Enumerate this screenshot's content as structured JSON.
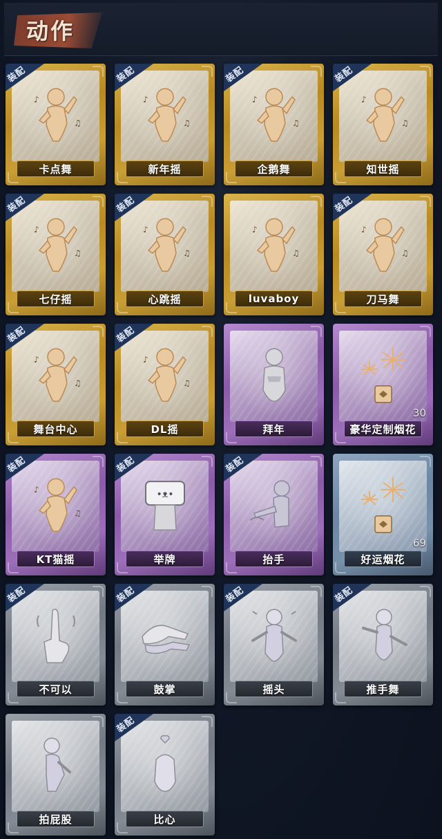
{
  "header": {
    "title": "动作"
  },
  "equip_badge_label": "装配",
  "rarity_colors": {
    "gold": "#c99e34",
    "purple": "#9d6fbb",
    "blue": "#7891ab",
    "gray": "#848b94"
  },
  "emotes": [
    {
      "label": "卡点舞",
      "rarity": "gold",
      "equipped": true,
      "icon": "dance-pose-icon"
    },
    {
      "label": "新年摇",
      "rarity": "gold",
      "equipped": true,
      "icon": "dance-pose-icon"
    },
    {
      "label": "企鹅舞",
      "rarity": "gold",
      "equipped": true,
      "icon": "dance-pose-icon"
    },
    {
      "label": "知世摇",
      "rarity": "gold",
      "equipped": true,
      "icon": "dance-pose-icon"
    },
    {
      "label": "七仔摇",
      "rarity": "gold",
      "equipped": true,
      "icon": "dance-pose-icon"
    },
    {
      "label": "心跳摇",
      "rarity": "gold",
      "equipped": true,
      "icon": "dance-pose-icon"
    },
    {
      "label": "luvaboy",
      "rarity": "gold",
      "equipped": false,
      "icon": "dance-pose-icon"
    },
    {
      "label": "刀马舞",
      "rarity": "gold",
      "equipped": true,
      "icon": "dance-pose-icon"
    },
    {
      "label": "舞台中心",
      "rarity": "gold",
      "equipped": true,
      "icon": "dance-pose-icon"
    },
    {
      "label": "DL摇",
      "rarity": "gold",
      "equipped": true,
      "icon": "dance-pose-icon"
    },
    {
      "label": "拜年",
      "rarity": "purple",
      "equipped": false,
      "icon": "bow-pose-icon"
    },
    {
      "label": "豪华定制烟花",
      "rarity": "purple",
      "equipped": false,
      "icon": "fireworks-icon",
      "count": "30"
    },
    {
      "label": "KT猫摇",
      "rarity": "purple",
      "equipped": true,
      "icon": "dance-pose-icon"
    },
    {
      "label": "举牌",
      "rarity": "purple",
      "equipped": true,
      "icon": "sign-hold-icon"
    },
    {
      "label": "抬手",
      "rarity": "purple",
      "equipped": true,
      "icon": "raise-hand-icon"
    },
    {
      "label": "好运烟花",
      "rarity": "blue",
      "equipped": false,
      "icon": "fireworks-icon",
      "count": "69"
    },
    {
      "label": "不可以",
      "rarity": "gray",
      "equipped": true,
      "icon": "finger-wag-icon"
    },
    {
      "label": "鼓掌",
      "rarity": "gray",
      "equipped": true,
      "icon": "clap-icon"
    },
    {
      "label": "摇头",
      "rarity": "gray",
      "equipped": true,
      "icon": "head-shake-icon"
    },
    {
      "label": "推手舞",
      "rarity": "gray",
      "equipped": true,
      "icon": "push-dance-icon"
    },
    {
      "label": "拍屁股",
      "rarity": "gray",
      "equipped": false,
      "icon": "butt-slap-icon"
    },
    {
      "label": "比心",
      "rarity": "gray",
      "equipped": true,
      "icon": "finger-heart-icon"
    }
  ]
}
